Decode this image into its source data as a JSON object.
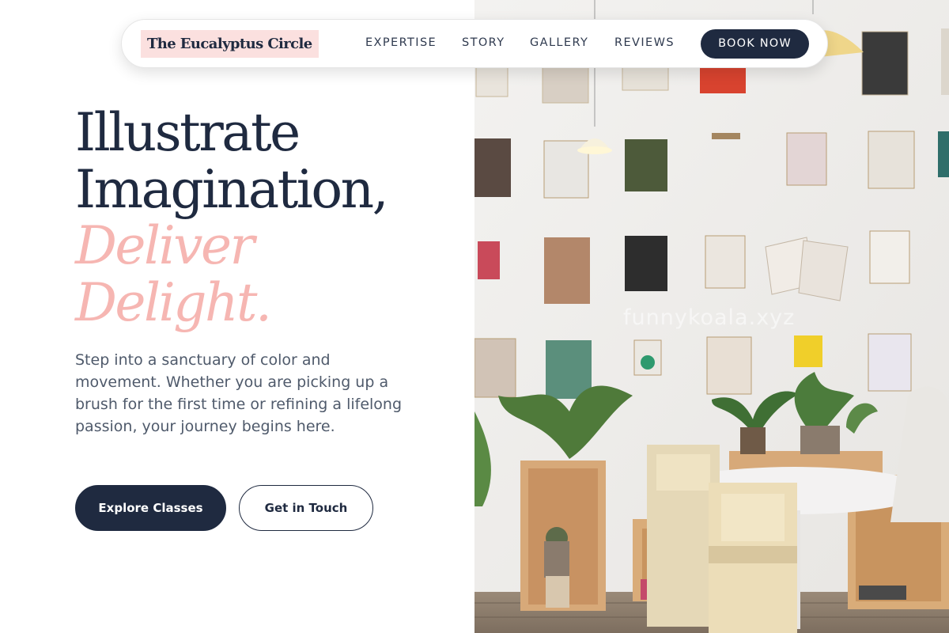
{
  "nav": {
    "brand": "The Eucalyptus Circle",
    "links": [
      "EXPERTISE",
      "STORY",
      "GALLERY",
      "REVIEWS"
    ],
    "cta": "BOOK NOW"
  },
  "hero": {
    "line1": "Illustrate",
    "line2": "Imagination,",
    "line3": "Deliver",
    "line4": "Delight.",
    "body": "Step into a sanctuary of color and movement. Whether you are picking up a brush for the first time or refining a lifelong passion, your journey begins here.",
    "primary_button": "Explore Classes",
    "secondary_button": "Get in Touch"
  },
  "photo": {
    "watermark": "funnykoala.xyz"
  },
  "colors": {
    "navy": "#1f2a40",
    "pink_accent": "#f6b6b2",
    "brand_highlight": "#fbe0df",
    "body_text": "#4f5a6b"
  }
}
